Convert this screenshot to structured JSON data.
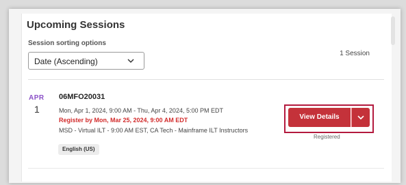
{
  "sessions": {
    "title": "Upcoming Sessions",
    "sort_label": "Session sorting options",
    "sort_value": "Date (Ascending)",
    "count": "1 Session"
  },
  "session": {
    "month": "APR",
    "day": "1",
    "code": "06MFO20031",
    "dates": "Mon, Apr 1, 2024, 9:00 AM - Thu, Apr 4, 2024, 5:00 PM EDT",
    "register_by": "Register by Mon, Mar 25, 2024, 9:00 AM EDT",
    "description": "MSD - Virtual ILT - 9:00 AM EST, CA Tech - Mainframe ILT Instructors",
    "language": "English (US)",
    "button_label": "View Details",
    "status": "Registered"
  },
  "colors": {
    "accent": "#c4323a",
    "month": "#8a4fc7",
    "register": "#d22b2b",
    "highlight": "#b3193d"
  }
}
